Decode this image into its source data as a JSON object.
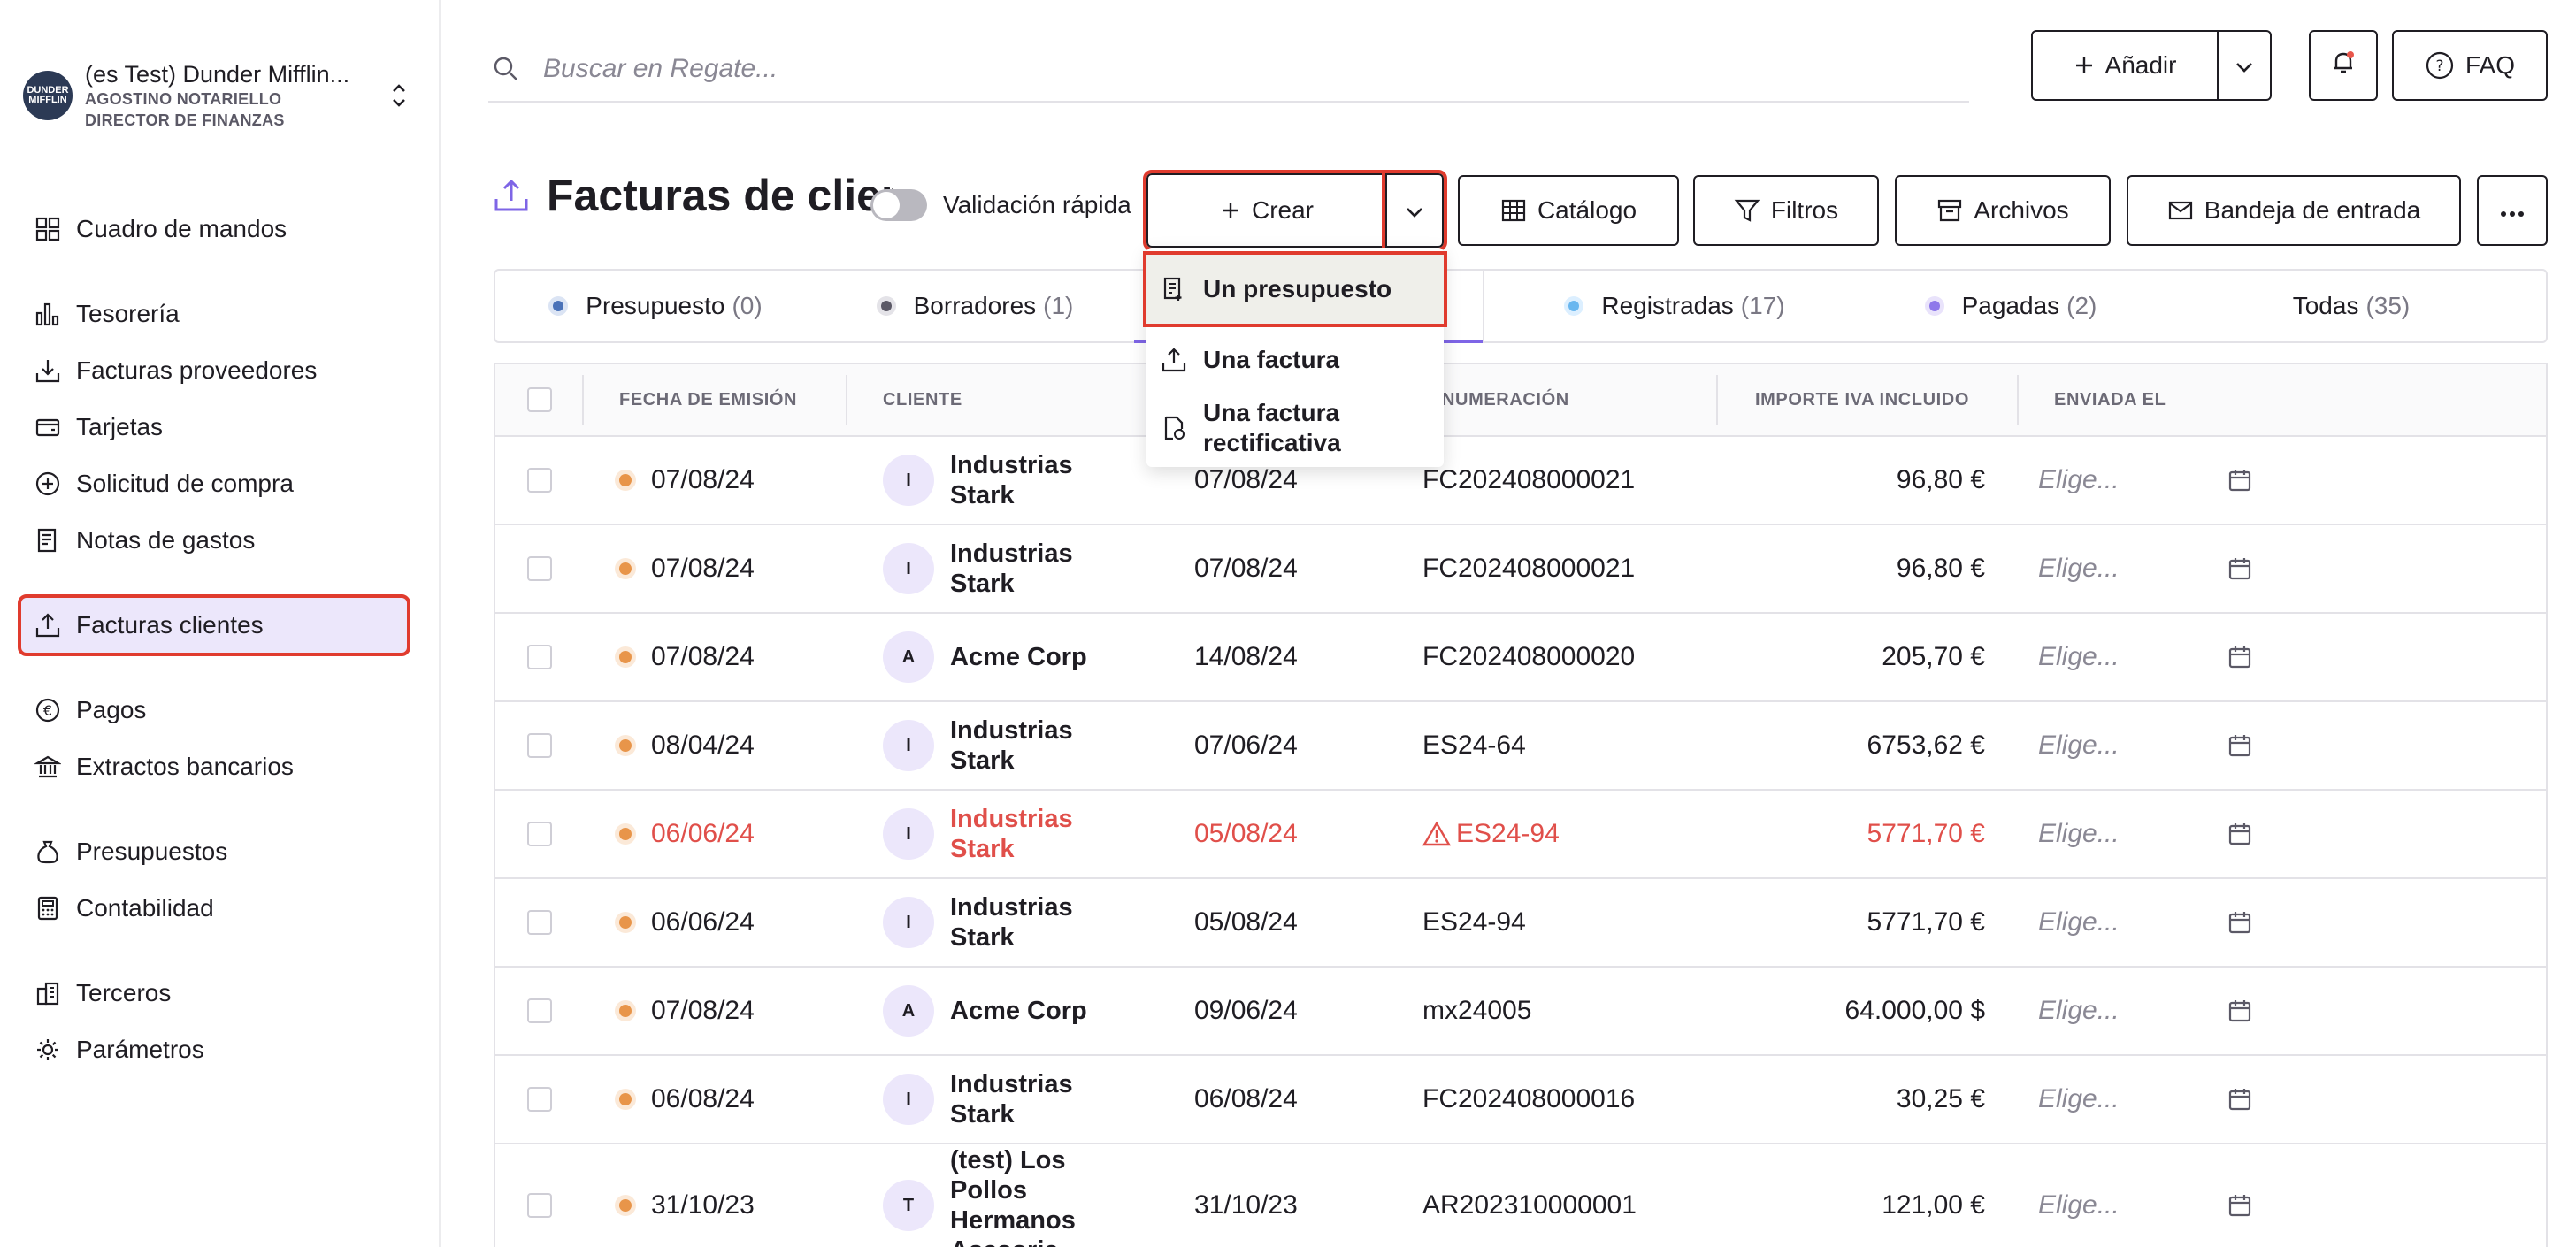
{
  "organization": {
    "name": "(es Test) Dunder Mifflin...",
    "user": "AGOSTINO NOTARIELLO",
    "role": "DIRECTOR DE FINANZAS",
    "logo_text": "DUNDER MIFFLIN"
  },
  "sidebar": {
    "items": [
      {
        "label": "Cuadro de mandos",
        "icon": "dashboard-icon"
      },
      {
        "label": "Tesorería",
        "icon": "bar-chart-icon"
      },
      {
        "label": "Facturas proveedores",
        "icon": "download-tray-icon"
      },
      {
        "label": "Tarjetas",
        "icon": "card-wallet-icon"
      },
      {
        "label": "Solicitud de compra",
        "icon": "plus-circle-icon"
      },
      {
        "label": "Notas de gastos",
        "icon": "receipt-icon"
      },
      {
        "label": "Facturas clientes",
        "icon": "upload-tray-icon",
        "active": true
      },
      {
        "label": "Pagos",
        "icon": "euro-circle-icon"
      },
      {
        "label": "Extractos bancarios",
        "icon": "bank-icon"
      },
      {
        "label": "Presupuestos",
        "icon": "money-bag-icon"
      },
      {
        "label": "Contabilidad",
        "icon": "calculator-icon"
      },
      {
        "label": "Terceros",
        "icon": "buildings-icon"
      },
      {
        "label": "Parámetros",
        "icon": "gear-icon"
      }
    ]
  },
  "header": {
    "search_placeholder": "Buscar en Regate...",
    "add_label": "Añadir",
    "faq_label": "FAQ"
  },
  "page": {
    "title": "Facturas de clientes",
    "quick_validation_label": "Validación rápida",
    "create_label": "Crear",
    "catalog_label": "Catálogo",
    "filters_label": "Filtros",
    "archives_label": "Archivos",
    "inbox_label": "Bandeja de entrada"
  },
  "create_menu": {
    "items": [
      "Un presupuesto",
      "Una factura",
      "Una factura rectificativa"
    ]
  },
  "tabs": [
    {
      "label": "Presupuesto",
      "count": "(0)",
      "color": "#4a72b8"
    },
    {
      "label": "Borradores",
      "count": "(1)",
      "color": "#5b5966"
    },
    {
      "label": "",
      "count": "",
      "color": ""
    },
    {
      "label": "Registradas",
      "count": "(17)",
      "color": "#6ab7ef"
    },
    {
      "label": "Pagadas",
      "count": "(2)",
      "color": "#8f79ea"
    },
    {
      "label": "Todas",
      "count": "(35)",
      "color": ""
    }
  ],
  "table": {
    "columns": [
      "FECHA DE EMISIÓN",
      "CLIENTE",
      "",
      "NUMERACIÓN",
      "IMPORTE IVA INCLUIDO",
      "ENVIADA EL"
    ],
    "placeholder_sent": "Elige...",
    "rows": [
      {
        "issue_date": "07/08/24",
        "avatar": "I",
        "client": "Industrias Stark",
        "due_date": "07/08/24",
        "number": "FC202408000021",
        "amount": "96,80 €"
      },
      {
        "issue_date": "07/08/24",
        "avatar": "I",
        "client": "Industrias Stark",
        "due_date": "07/08/24",
        "number": "FC202408000021",
        "amount": "96,80 €"
      },
      {
        "issue_date": "07/08/24",
        "avatar": "A",
        "client": "Acme Corp",
        "due_date": "14/08/24",
        "number": "FC202408000020",
        "amount": "205,70 €"
      },
      {
        "issue_date": "08/04/24",
        "avatar": "I",
        "client": "Industrias Stark",
        "due_date": "07/06/24",
        "number": "ES24-64",
        "amount": "6753,62 €"
      },
      {
        "issue_date": "06/06/24",
        "avatar": "I",
        "client": "Industrias Stark",
        "due_date": "05/08/24",
        "number": "ES24-94",
        "amount": "5771,70 €",
        "warning": true
      },
      {
        "issue_date": "06/06/24",
        "avatar": "I",
        "client": "Industrias Stark",
        "due_date": "05/08/24",
        "number": "ES24-94",
        "amount": "5771,70 €"
      },
      {
        "issue_date": "07/08/24",
        "avatar": "A",
        "client": "Acme Corp",
        "due_date": "09/06/24",
        "number": "mx24005",
        "amount": "64.000,00 $"
      },
      {
        "issue_date": "06/08/24",
        "avatar": "I",
        "client": "Industrias Stark",
        "due_date": "06/08/24",
        "number": "FC202408000016",
        "amount": "30,25 €"
      },
      {
        "issue_date": "31/10/23",
        "avatar": "T",
        "client": "(test) Los Pollos Hermanos Asesoria",
        "due_date": "31/10/23",
        "number": "AR202310000001",
        "amount": "121,00 €"
      }
    ]
  },
  "colors": {
    "accent": "#7e65e6",
    "highlight": "#e03b2e",
    "warning": "#e04f4a",
    "status_dot": "#e8954a"
  }
}
